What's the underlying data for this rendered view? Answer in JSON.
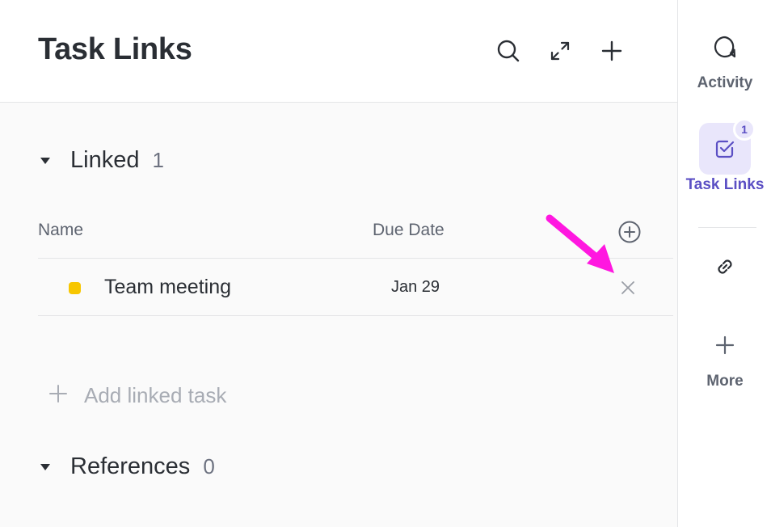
{
  "header": {
    "title": "Task Links"
  },
  "linked_section": {
    "title": "Linked",
    "count": "1",
    "columns": {
      "name": "Name",
      "due_date": "Due Date"
    },
    "rows": [
      {
        "name": "Team meeting",
        "due_date": "Jan 29",
        "status_color": "#f7c600"
      }
    ],
    "add_label": "Add linked task"
  },
  "references_section": {
    "title": "References",
    "count": "0"
  },
  "sidebar": {
    "items": [
      {
        "label": "Activity",
        "icon": "chat-bubble-icon"
      },
      {
        "label": "Task Links",
        "icon": "checkbox-icon",
        "badge": "1",
        "active": true
      },
      {
        "label": "",
        "icon": "link-icon"
      },
      {
        "label": "More",
        "icon": "plus-icon"
      }
    ]
  },
  "colors": {
    "accent": "#5b4fc4",
    "accent_bg": "#e9e6fb",
    "annotation_arrow": "#ff17e0"
  }
}
